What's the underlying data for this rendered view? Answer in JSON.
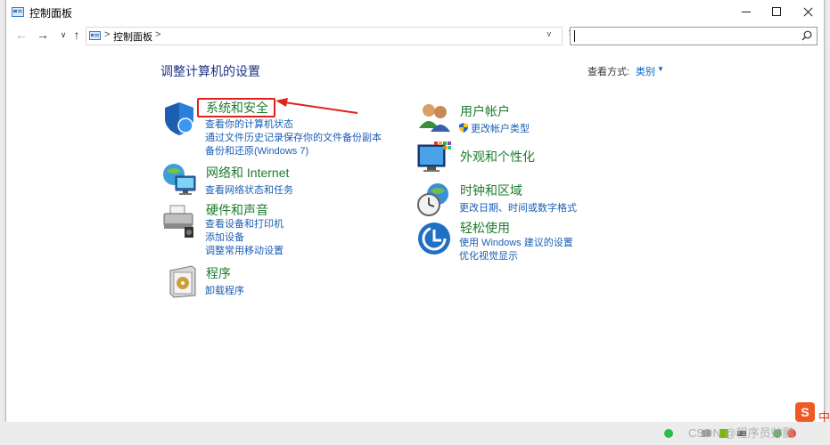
{
  "window": {
    "title": "控制面板"
  },
  "addressbar": {
    "sep": ">",
    "crumb": "控制面板",
    "sep2": ">",
    "dropdown": "v"
  },
  "content": {
    "heading": "调整计算机的设置",
    "viewby_label": "查看方式:",
    "viewby_value": "类别"
  },
  "categories": {
    "system": {
      "title": "系统和安全",
      "links": [
        "查看你的计算机状态",
        "通过文件历史记录保存你的文件备份副本",
        "备份和还原(Windows 7)"
      ]
    },
    "network": {
      "title": "网络和 Internet",
      "links": [
        "查看网络状态和任务"
      ]
    },
    "hardware": {
      "title": "硬件和声音",
      "links": [
        "查看设备和打印机",
        "添加设备",
        "调整常用移动设置"
      ]
    },
    "programs": {
      "title": "程序",
      "links": [
        "卸载程序"
      ]
    },
    "users": {
      "title": "用户帐户",
      "links": [
        "更改帐户类型"
      ]
    },
    "appearance": {
      "title": "外观和个性化",
      "links": []
    },
    "clock": {
      "title": "时钟和区域",
      "links": [
        "更改日期、时间或数字格式"
      ]
    },
    "ease": {
      "title": "轻松使用",
      "links": [
        "使用 Windows 建议的设置",
        "优化视觉显示"
      ]
    }
  },
  "taskbar": {
    "watermark": "CSDN @程序员帅鹏",
    "ime_badge": "S",
    "ime_lang": "中"
  },
  "colors": {
    "category_title": "#1e7b2f",
    "link": "#1a5fb4",
    "heading": "#1e3287",
    "annotation": "#e0211c"
  }
}
